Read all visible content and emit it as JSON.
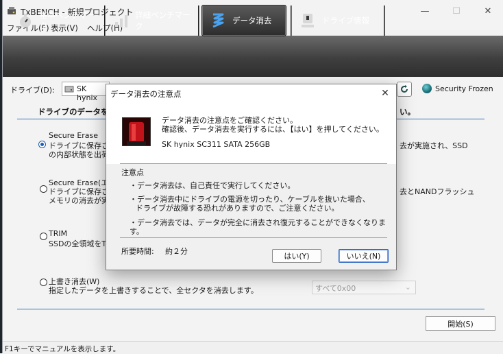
{
  "window": {
    "title": "TxBENCH - 新規プロジェクト",
    "minimize": "—",
    "maximize": "☐",
    "close": "✕"
  },
  "menu": [
    "ファイル(F)",
    "表示(V)",
    "ヘルプ(H)"
  ],
  "toolbar": {
    "tabs": [
      {
        "label": "基本ベンチマーク",
        "icon": "stopwatch-icon"
      },
      {
        "label": "詳細ベンチマーク",
        "icon": "bar-chart-icon"
      },
      {
        "label": "データ消去",
        "icon": "erase-icon",
        "active": true
      },
      {
        "label": "ドライブ情報",
        "icon": "drive-info-icon"
      }
    ]
  },
  "drive": {
    "label": "ドライブ(D):",
    "selected": "SK hynix",
    "security_status": "Security Frozen"
  },
  "main": {
    "heading_left": "ドライブのデータを完",
    "heading_right": "い。",
    "options": [
      {
        "title": "Secure Erase",
        "line1": "ドライブに保存され",
        "line2": "の内部状態を出荷",
        "right": "去が実施され、SSD",
        "selected": true
      },
      {
        "title": "Secure Erase(エン",
        "line1": "ドライブに保存され",
        "line2": "メモリの消去が実施",
        "right": "去とNANDフラッシュ",
        "selected": false
      },
      {
        "title": "TRIM",
        "line1": "SSDの全領域をTR",
        "selected": false
      },
      {
        "title": "上書き消去(W)",
        "line1": "指定したデータを上書きすることで、全セクタを消去します。",
        "selected": false
      }
    ],
    "fill_value": "すべて0x00",
    "start_button": "開始(S)"
  },
  "status_bar": "F1キーでマニュアルを表示します。",
  "dialog": {
    "title": "データ消去の注意点",
    "intro_line1": "データ消去の注意点をご確認ください。",
    "intro_line2": "確認後、データ消去を実行するには、【はい】を押してください。",
    "drive_name": "SK hynix SC311 SATA 256GB",
    "notes_heading": "注意点",
    "note1": "・データ消去は、自己責任で実行してください。",
    "note2_line1": "・データ消去中にドライブの電源を切ったり、ケーブルを抜いた場合、",
    "note2_line2": "ドライブが故障する恐れがありますので、ご注意ください。",
    "note3": "・データ消去では、データが完全に消去され復元することができなくなります。",
    "time_label": "所要時間:",
    "time_value": "約２分",
    "yes_button": "はい(Y)",
    "no_button": "いいえ(N)"
  }
}
